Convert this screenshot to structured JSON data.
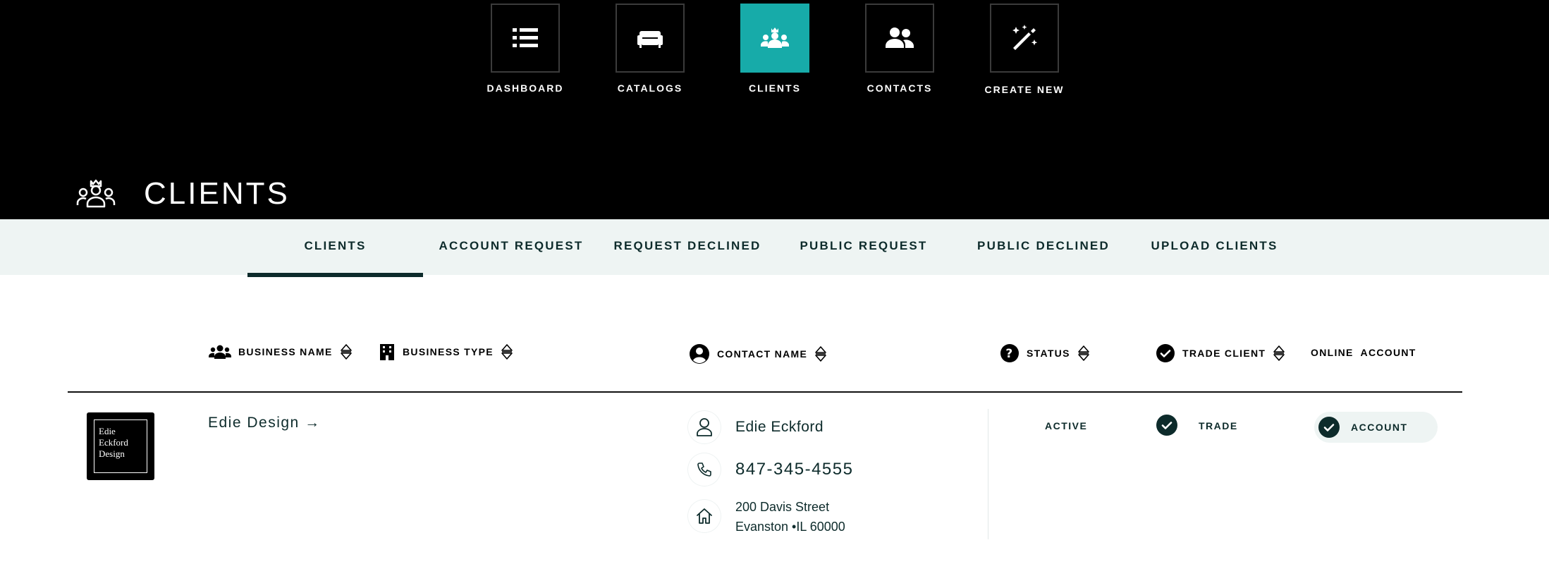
{
  "nav": {
    "items": [
      {
        "label": "DASHBOARD",
        "icon": "list-icon"
      },
      {
        "label": "CATALOGS",
        "icon": "sofa-icon"
      },
      {
        "label": "CLIENTS",
        "icon": "clients-icon",
        "active": true
      },
      {
        "label": "CONTACTS",
        "icon": "contacts-icon"
      },
      {
        "label": "CREATE NEW",
        "icon": "magic-wand-icon"
      }
    ]
  },
  "page": {
    "title": "CLIENTS",
    "icon": "clients-outline-icon"
  },
  "tabs": [
    {
      "label": "CLIENTS",
      "active": true
    },
    {
      "label": "ACCOUNT REQUEST"
    },
    {
      "label": "REQUEST DECLINED"
    },
    {
      "label": "PUBLIC REQUEST"
    },
    {
      "label": "PUBLIC DECLINED"
    },
    {
      "label": "UPLOAD CLIENTS"
    }
  ],
  "columns": {
    "business_name": "BUSINESS NAME",
    "business_type": "BUSINESS TYPE",
    "contact_name": "CONTACT NAME",
    "status": "STATUS",
    "trade_client": "TRADE CLIENT",
    "online_account": "ONLINE  ACCOUNT"
  },
  "rows": [
    {
      "logo_text": [
        "Edie",
        "Eckford",
        "Design"
      ],
      "business_name": "Edie Design →",
      "contact_name": "Edie Eckford",
      "phone": "847-345-4555",
      "address_line1": "200 Davis Street",
      "address_line2": "Evanston •IL 60000",
      "status": "ACTIVE",
      "trade": "TRADE",
      "account": "ACCOUNT"
    }
  ],
  "colors": {
    "active_nav": "#17aba9",
    "dark_teal": "#0d2b2b",
    "tab_bg": "#eef4f3"
  }
}
